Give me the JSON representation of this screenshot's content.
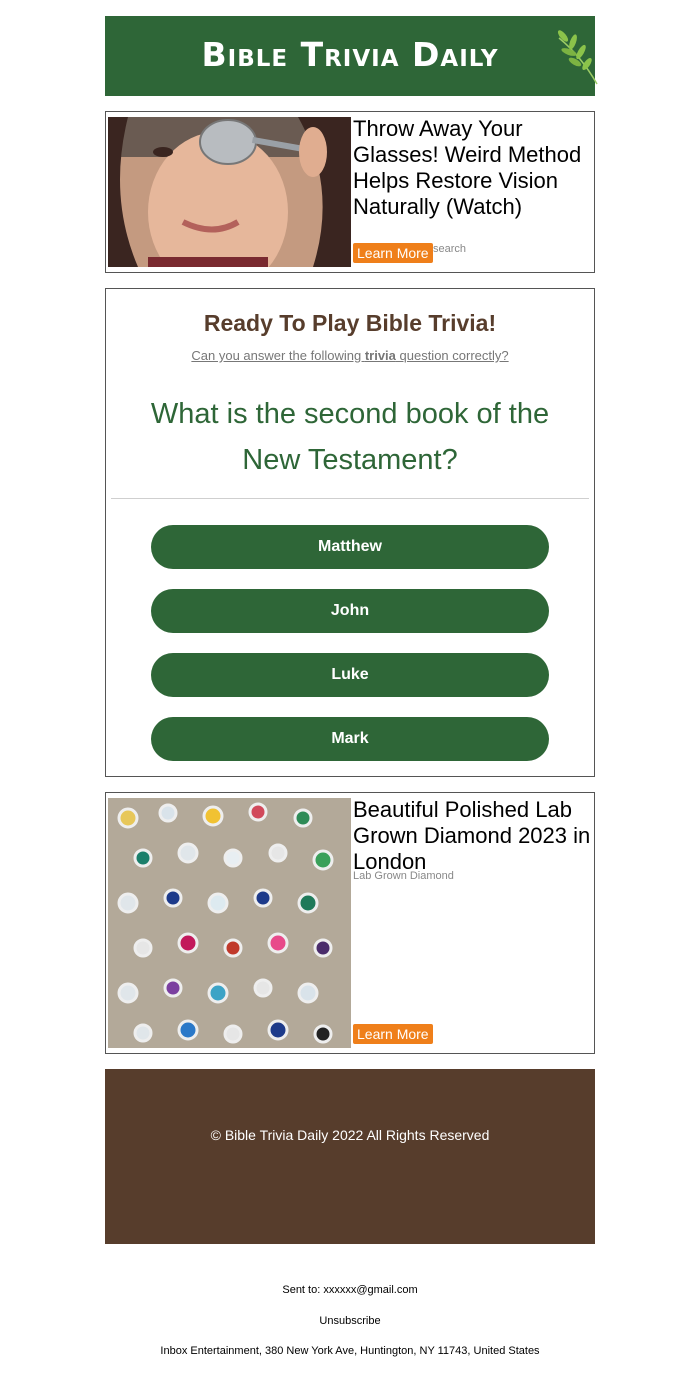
{
  "header": {
    "logo_text": "Bible Trivia Daily",
    "bg_color": "#2e6637"
  },
  "ad1": {
    "title": "Throw Away Your Glasses! Weird Method Helps Restore Vision Naturally (Watch)",
    "sponsor": "search",
    "button_label": "Learn More"
  },
  "quiz": {
    "heading": "Ready To Play Bible Trivia!",
    "subtitle_pre": "Can you answer the following ",
    "subtitle_bold": "trivia",
    "subtitle_post": " question correctly?",
    "question": "What is the second book of the New Testament?",
    "answers": [
      "Matthew",
      "John",
      "Luke",
      "Mark"
    ]
  },
  "ad2": {
    "title": "Beautiful Polished Lab Grown Diamond 2023 in London",
    "sponsor": "Lab Grown Diamond",
    "button_label": "Learn More"
  },
  "footer": {
    "copyright": "© Bible Trivia Daily 2022 All Rights Reserved",
    "bg_color": "#573d2c"
  },
  "meta": {
    "sent_to": "Sent to: xxxxxx@gmail.com",
    "unsubscribe": "Unsubscribe",
    "address": "Inbox Entertainment, 380 New York Ave, Huntington, NY 11743, United States"
  },
  "colors": {
    "accent_green": "#2e6637",
    "heading_brown": "#573d2c",
    "button_orange": "#ef7f1a"
  }
}
